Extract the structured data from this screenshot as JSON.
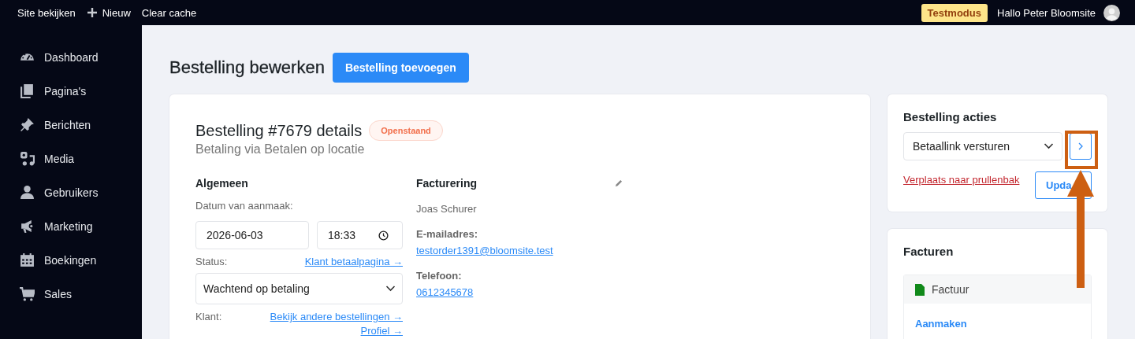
{
  "topbar": {
    "links": [
      {
        "label": "Site bekijken",
        "kind": "plain"
      },
      {
        "label": "Nieuw",
        "kind": "new"
      },
      {
        "label": "Clear cache",
        "kind": "plain"
      }
    ],
    "badge": "Testmodus",
    "greeting": "Hallo Peter Bloomsite"
  },
  "sidebar": {
    "items": [
      {
        "label": "Dashboard"
      },
      {
        "label": "Pagina's"
      },
      {
        "label": "Berichten"
      },
      {
        "label": "Media"
      },
      {
        "label": "Gebruikers"
      },
      {
        "label": "Marketing"
      },
      {
        "label": "Boekingen"
      },
      {
        "label": "Sales"
      }
    ]
  },
  "page": {
    "title": "Bestelling bewerken",
    "add_button": "Bestelling toevoegen"
  },
  "order": {
    "title": "Bestelling #7679 details",
    "status": "Openstaand",
    "subtitle": "Betaling via Betalen op locatie",
    "general": {
      "heading": "Algemeen",
      "date_label": "Datum van aanmaak:",
      "date": "2026-06-03",
      "time": "18:33",
      "status_label": "Status:",
      "status_link": "Klant betaalpagina →",
      "status_value": "Wachtend op betaling",
      "customer_label": "Klant:",
      "customer_links": [
        "Bekijk andere bestellingen →",
        "Profiel →"
      ]
    },
    "billing": {
      "heading": "Facturering",
      "name": "Joas Schurer",
      "email_label": "E-mailadres:",
      "email": "testorder1391@bloomsite.test",
      "phone_label": "Telefoon:",
      "phone": "0612345678"
    }
  },
  "actions": {
    "title": "Bestelling acties",
    "action": "Betaallink versturen",
    "trash": "Verplaats naar prullenbak",
    "update": "Upda"
  },
  "invoices": {
    "title": "Facturen",
    "items": [
      {
        "name": "Factuur",
        "action": "Aanmaken"
      }
    ]
  }
}
